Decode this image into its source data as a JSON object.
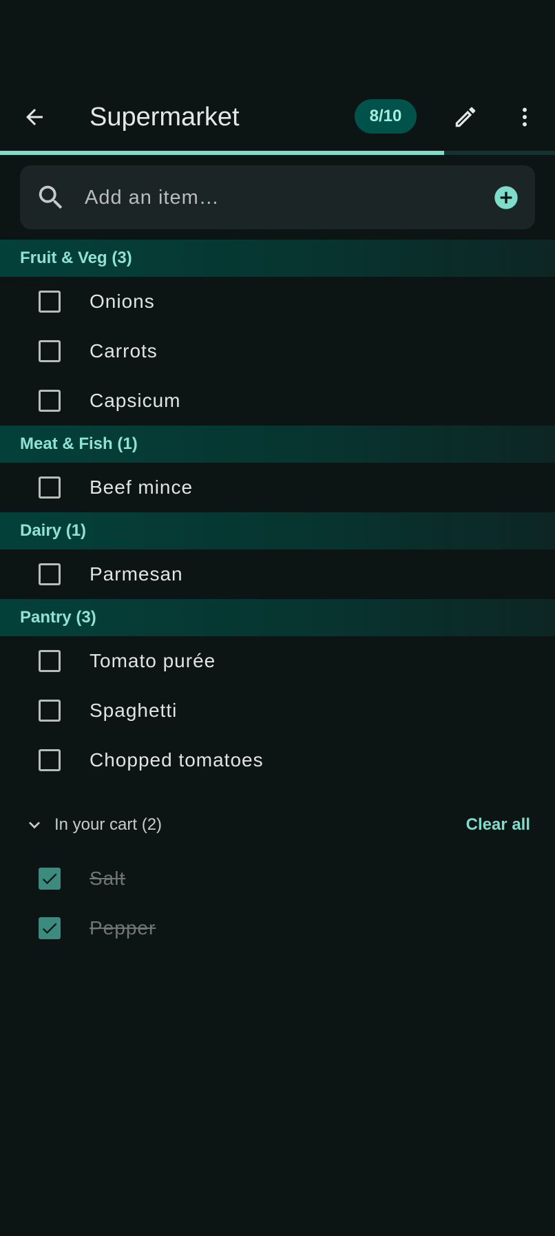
{
  "header": {
    "title": "Supermarket",
    "progress_text": "8/10",
    "progress_fraction": 0.8
  },
  "search": {
    "placeholder": "Add an item…"
  },
  "categories": [
    {
      "label": "Fruit & Veg (3)",
      "items": [
        "Onions",
        "Carrots",
        "Capsicum"
      ]
    },
    {
      "label": "Meat & Fish (1)",
      "items": [
        "Beef mince"
      ]
    },
    {
      "label": "Dairy (1)",
      "items": [
        "Parmesan"
      ]
    },
    {
      "label": "Pantry (3)",
      "items": [
        "Tomato purée",
        "Spaghetti",
        "Chopped tomatoes"
      ]
    }
  ],
  "cart": {
    "title": "In your cart (2)",
    "clear_label": "Clear all",
    "items": [
      "Salt",
      "Pepper"
    ]
  },
  "colors": {
    "accent": "#7fdccb",
    "background": "#0d1414",
    "category_bg": "#04403a",
    "pill_bg": "#00524a"
  }
}
